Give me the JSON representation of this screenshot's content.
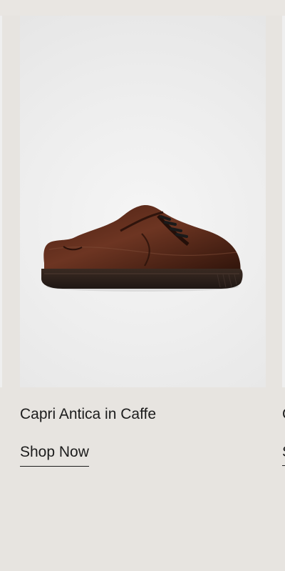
{
  "product": {
    "title": "Capri Antica in Caffe",
    "cta_label": "Shop Now",
    "image_icon": "brown-leather-sneaker-image"
  },
  "next_product": {
    "title_peek": "C",
    "cta_peek": "S"
  },
  "colors": {
    "background": "#e7e4e0",
    "image_background": "#ededed",
    "text": "#1c1c1c",
    "shoe_brown": "#5a2d1c"
  }
}
